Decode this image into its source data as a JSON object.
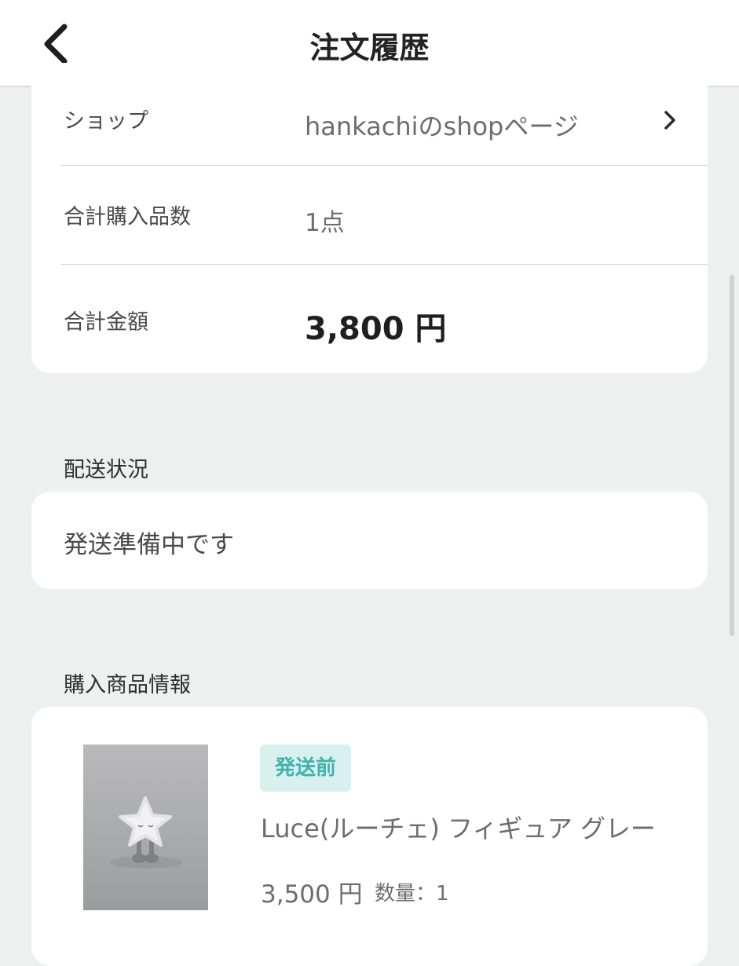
{
  "header": {
    "title": "注文履歴",
    "back_icon": "chevron-left-icon"
  },
  "order_summary": {
    "shop_label": "ショップ",
    "shop_value": "hankachiのshopページ",
    "quantity_label": "合計購入品数",
    "quantity_value": "1点",
    "total_label": "合計金額",
    "total_value": "3,800 円"
  },
  "shipping": {
    "section_title": "配送状況",
    "status_text": "発送準備中です"
  },
  "product": {
    "section_title": "購入商品情報",
    "badge": "発送前",
    "name": "Luce(ルーチェ) フィギュア グレー",
    "price": "3,500 円",
    "quantity": "数量：1"
  },
  "colors": {
    "background": "#eeefef",
    "badge_bg": "#d8f1ef",
    "badge_text": "#3fb3ac"
  }
}
